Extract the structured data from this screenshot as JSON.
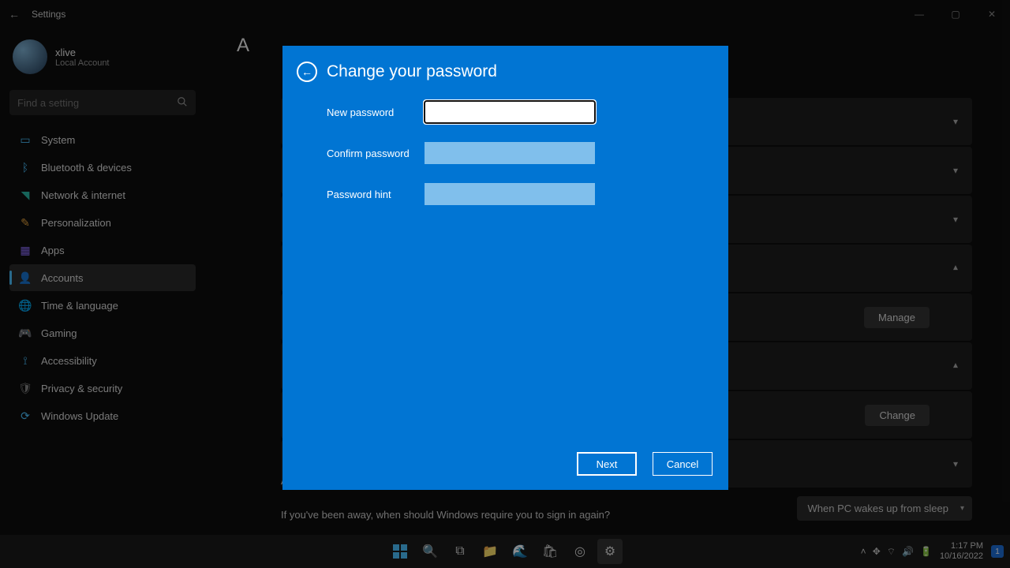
{
  "window": {
    "title": "Settings"
  },
  "user": {
    "name": "xlive",
    "account_type": "Local Account"
  },
  "search": {
    "placeholder": "Find a setting"
  },
  "sidebar": {
    "items": [
      {
        "label": "System"
      },
      {
        "label": "Bluetooth & devices"
      },
      {
        "label": "Network & internet"
      },
      {
        "label": "Personalization"
      },
      {
        "label": "Apps"
      },
      {
        "label": "Accounts",
        "active": true
      },
      {
        "label": "Time & language"
      },
      {
        "label": "Gaming"
      },
      {
        "label": "Accessibility"
      },
      {
        "label": "Privacy & security"
      },
      {
        "label": "Windows Update"
      }
    ]
  },
  "main": {
    "breadcrumb_prefix": "A",
    "buttons": {
      "manage": "Manage",
      "change": "Change"
    },
    "additional_label_partial": "A",
    "away_text": "If you've been away, when should Windows require you to sign in again?",
    "wake_option": "When PC wakes up from sleep"
  },
  "dialog": {
    "title": "Change your password",
    "fields": [
      {
        "label": "New password"
      },
      {
        "label": "Confirm password"
      },
      {
        "label": "Password hint"
      }
    ],
    "buttons": {
      "next": "Next",
      "cancel": "Cancel"
    }
  },
  "taskbar": {
    "time": "1:17 PM",
    "date": "10/16/2022",
    "notif_count": "1"
  }
}
